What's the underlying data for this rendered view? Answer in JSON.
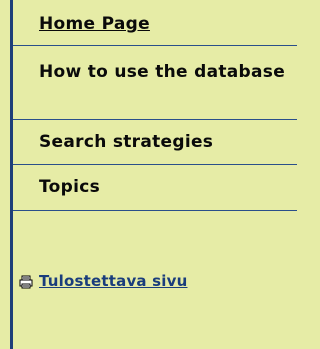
{
  "nav": {
    "items": [
      {
        "label": "Home Page",
        "active": true
      },
      {
        "label": "How to use the database",
        "active": false
      },
      {
        "label": "Search strategies",
        "active": false
      },
      {
        "label": "Topics",
        "active": false
      }
    ]
  },
  "print": {
    "label": "Tulostettava sivu",
    "icon": "printer-icon"
  },
  "colors": {
    "background": "#e6eca6",
    "border": "#1e3f79",
    "link": "#1a3d7c"
  }
}
